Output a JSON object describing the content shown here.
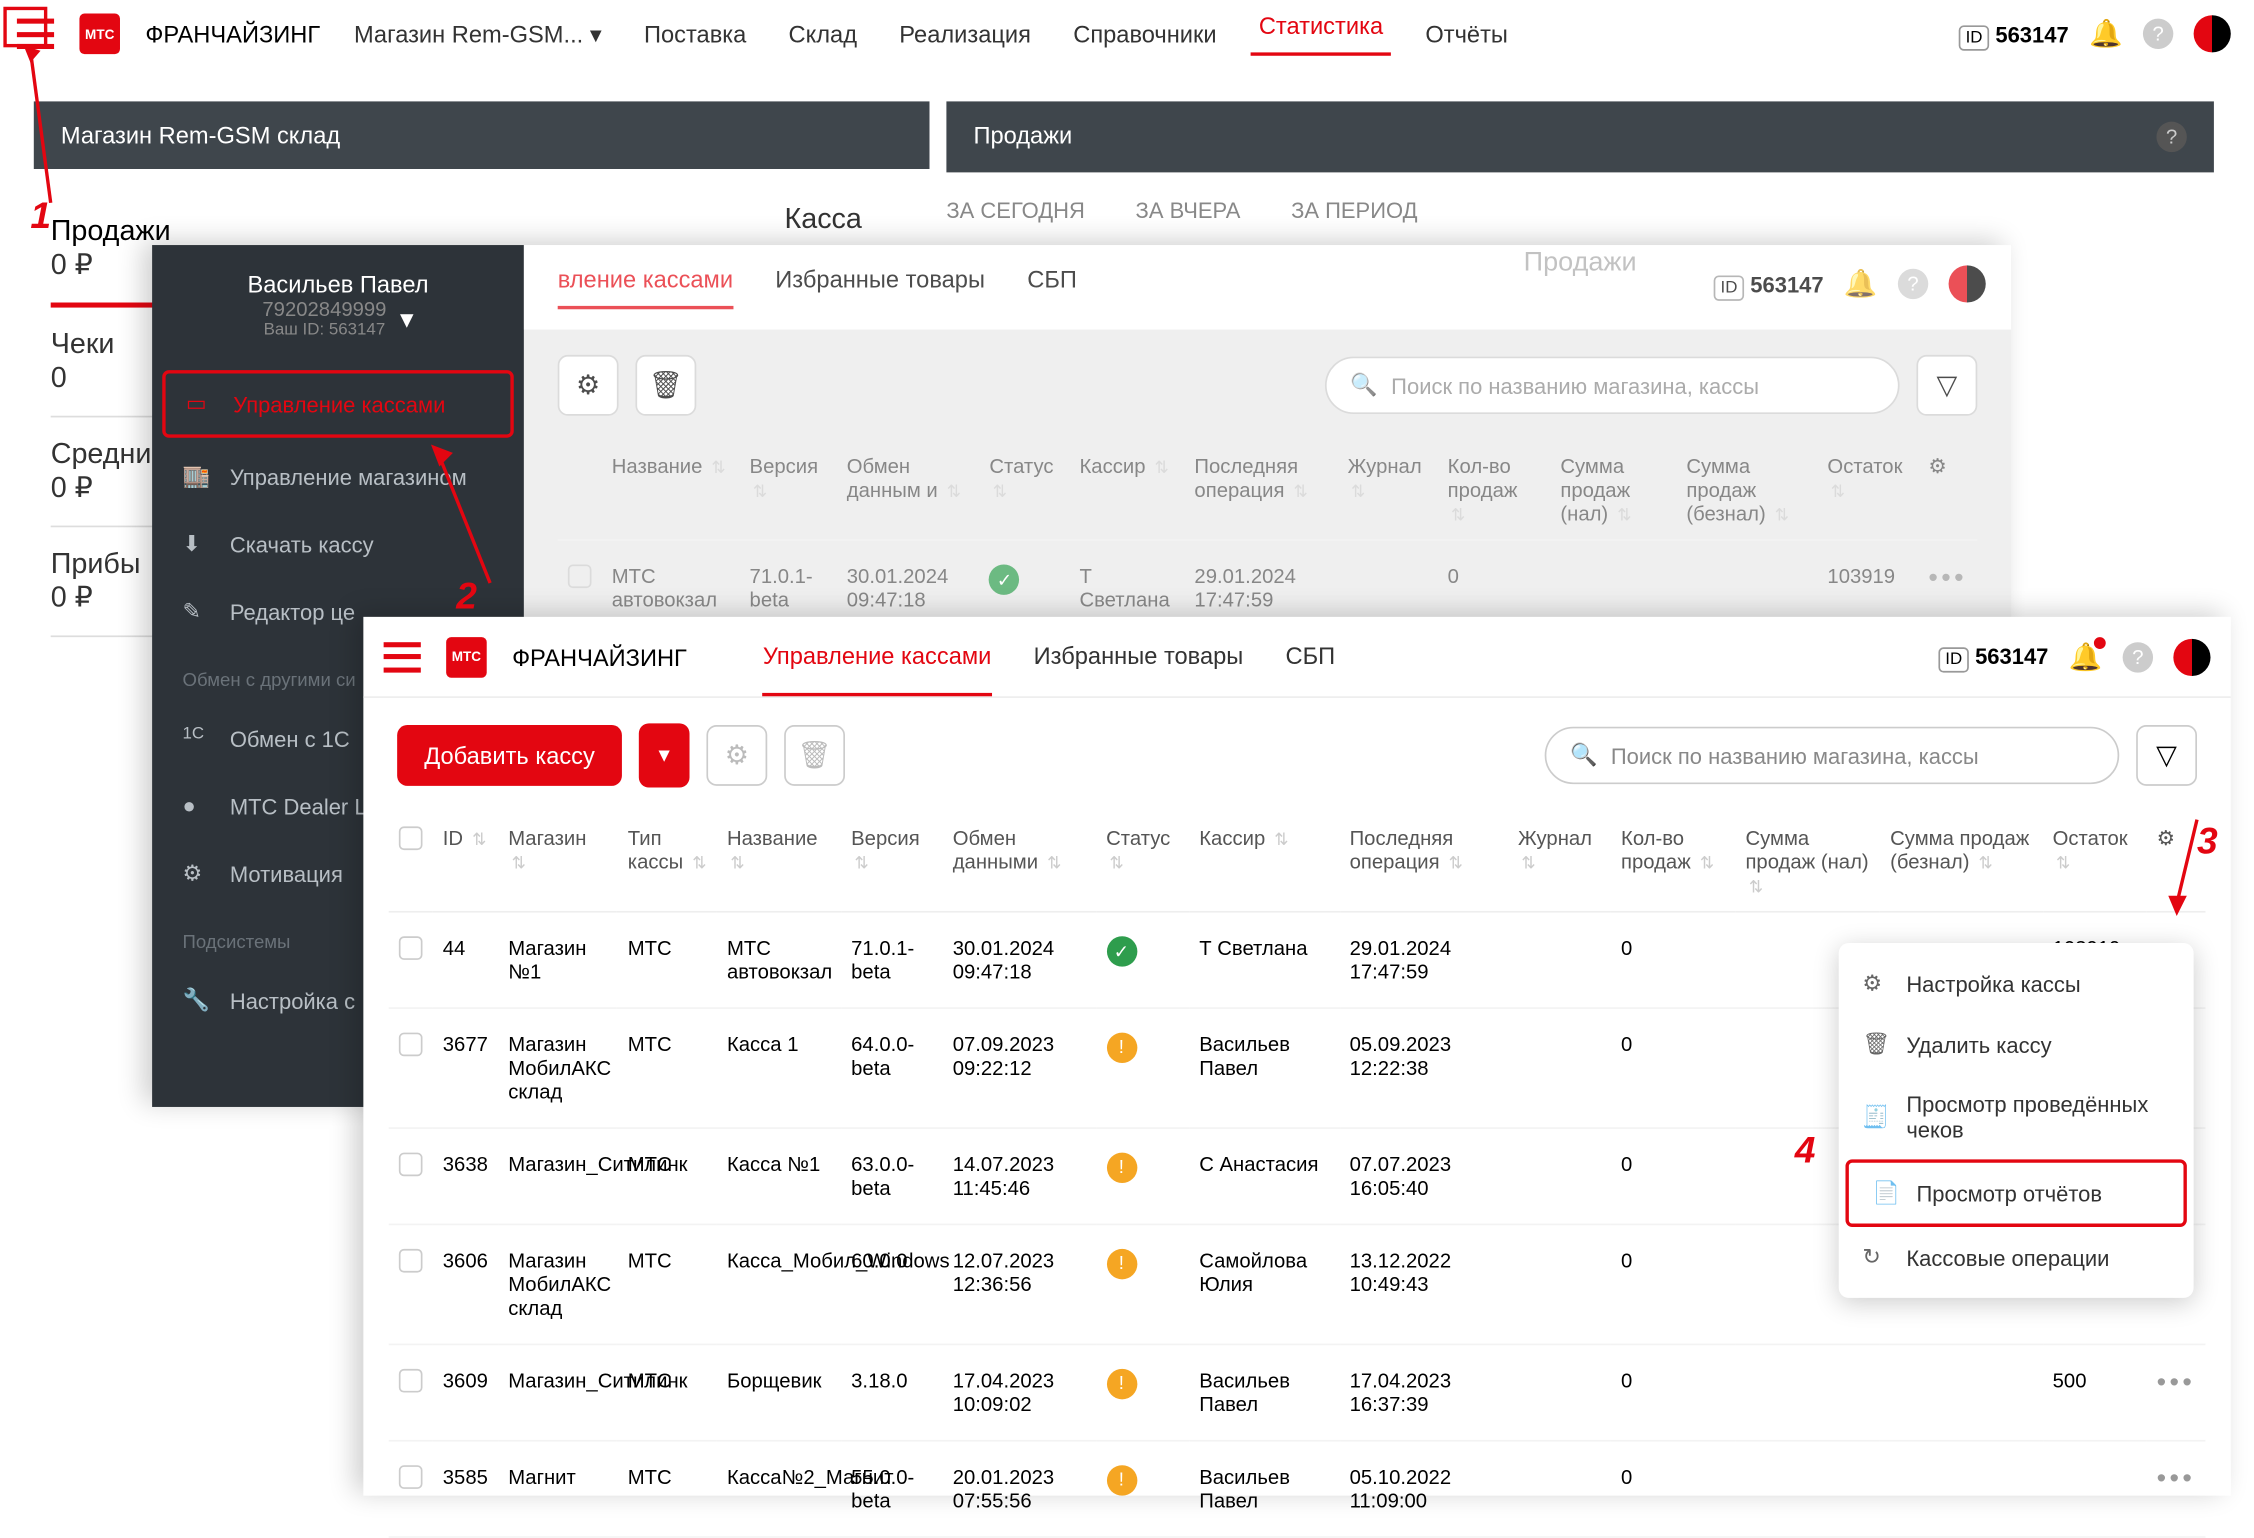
{
  "brand": "ФРАНЧАЙЗИНГ",
  "store_selector": "Магазин Rem-GSM...",
  "nav": [
    "Поставка",
    "Склад",
    "Реализация",
    "Справочники",
    "Статистика",
    "Отчёты"
  ],
  "nav_active": "Статистика",
  "id_label": "ID",
  "id_value": "563147",
  "layer1": {
    "panel_title": "Магазин Rem-GSM склад",
    "kassa": "Касса",
    "stats": [
      {
        "label": "Продажи",
        "value": "0 ₽"
      },
      {
        "label": "Чеки",
        "value": "0"
      },
      {
        "label": "Средни",
        "value": "0 ₽"
      },
      {
        "label": "Прибы",
        "value": "0 ₽"
      }
    ],
    "sales_panel": "Продажи",
    "tabs": [
      "ЗА СЕГОДНЯ",
      "ЗА ВЧЕРА",
      "ЗА ПЕРИОД"
    ],
    "subtitle": "Продажи"
  },
  "sidebar": {
    "user_name": "Васильев Павел",
    "user_phone": "79202849999",
    "user_id": "Ваш ID: 563147",
    "items": [
      {
        "label": "Управление кассами",
        "highlight": true
      },
      {
        "label": "Управление магазином"
      },
      {
        "label": "Скачать кассу"
      },
      {
        "label": "Редактор це"
      }
    ],
    "section1": "Обмен с другими си",
    "items2": [
      {
        "label": "Обмен с 1С"
      },
      {
        "label": "MTC Dealer L"
      },
      {
        "label": "Мотивация"
      }
    ],
    "section2": "Подсистемы",
    "items3": [
      {
        "label": "Настройка с"
      }
    ]
  },
  "layer2": {
    "tabs": [
      "вление кассами",
      "Избранные товары",
      "СБП"
    ],
    "search_placeholder": "Поиск по названию магазина, кассы",
    "row": {
      "name": "МТС автовокзал",
      "version": "71.0.1-beta",
      "date": "30.01.2024 09:47:18",
      "cashier": "Т Светлана",
      "last_op": "29.01.2024 17:47:59",
      "qty": "0",
      "balance": "103919"
    }
  },
  "layer3": {
    "tabs": [
      "Управление кассами",
      "Избранные товары",
      "СБП"
    ],
    "add_btn": "Добавить кассу",
    "search_placeholder": "Поиск по названию магазина, кассы",
    "columns": [
      "ID",
      "Магазин",
      "Тип кассы",
      "Название",
      "Версия",
      "Обмен данными",
      "Статус",
      "Кассир",
      "Последняя операция",
      "Журнал",
      "Кол-во продаж",
      "Сумма продаж (нал)",
      "Сумма продаж (безнал)",
      "Остаток"
    ],
    "rows": [
      {
        "id": "44",
        "store": "Магазин №1",
        "type": "МТС",
        "name": "МТС автовокзал",
        "version": "71.0.1-beta",
        "exchange": "30.01.2024 09:47:18",
        "status": "ok",
        "cashier": "Т Светлана",
        "last_op": "29.01.2024 17:47:59",
        "qty": "0",
        "balance": "103919"
      },
      {
        "id": "3677",
        "store": "Магазин МобилАКС склад",
        "type": "МТС",
        "name": "Касса 1",
        "version": "64.0.0-beta",
        "exchange": "07.09.2023 09:22:12",
        "status": "warn",
        "cashier": "Васильев Павел",
        "last_op": "05.09.2023 12:22:38",
        "qty": "0",
        "balance": ""
      },
      {
        "id": "3638",
        "store": "Магазин_Ситилинк",
        "type": "МТС",
        "name": "Касса №1",
        "version": "63.0.0-beta",
        "exchange": "14.07.2023 11:45:46",
        "status": "warn",
        "cashier": "С Анастасия",
        "last_op": "07.07.2023 16:05:40",
        "qty": "0",
        "balance": ""
      },
      {
        "id": "3606",
        "store": "Магазин МобилАКС склад",
        "type": "МТС",
        "name": "Касса_Мобил_Windows",
        "version": "60.0.0",
        "exchange": "12.07.2023 12:36:56",
        "status": "warn",
        "cashier": "Самойлова Юлия",
        "last_op": "13.12.2022 10:49:43",
        "qty": "0",
        "balance": ""
      },
      {
        "id": "3609",
        "store": "Магазин_Ситилинк",
        "type": "МТС",
        "name": "Борщевик",
        "version": "3.18.0",
        "exchange": "17.04.2023 10:09:02",
        "status": "warn",
        "cashier": "Васильев Павел",
        "last_op": "17.04.2023 16:37:39",
        "qty": "0",
        "balance": "500"
      },
      {
        "id": "3585",
        "store": "Магнит",
        "type": "МТС",
        "name": "Касса№2_Магнит",
        "version": "55.0.0-beta",
        "exchange": "20.01.2023 07:55:56",
        "status": "warn",
        "cashier": "Васильев Павел",
        "last_op": "05.10.2022 11:09:00",
        "qty": "0",
        "balance": ""
      }
    ]
  },
  "ctx": {
    "items": [
      {
        "label": "Настройка кассы"
      },
      {
        "label": "Удалить кассу"
      },
      {
        "label": "Просмотр проведённых чеков"
      },
      {
        "label": "Просмотр отчётов",
        "highlight": true
      },
      {
        "label": "Кассовые операции"
      }
    ]
  },
  "anno": {
    "1": "1",
    "2": "2",
    "3": "3",
    "4": "4"
  }
}
